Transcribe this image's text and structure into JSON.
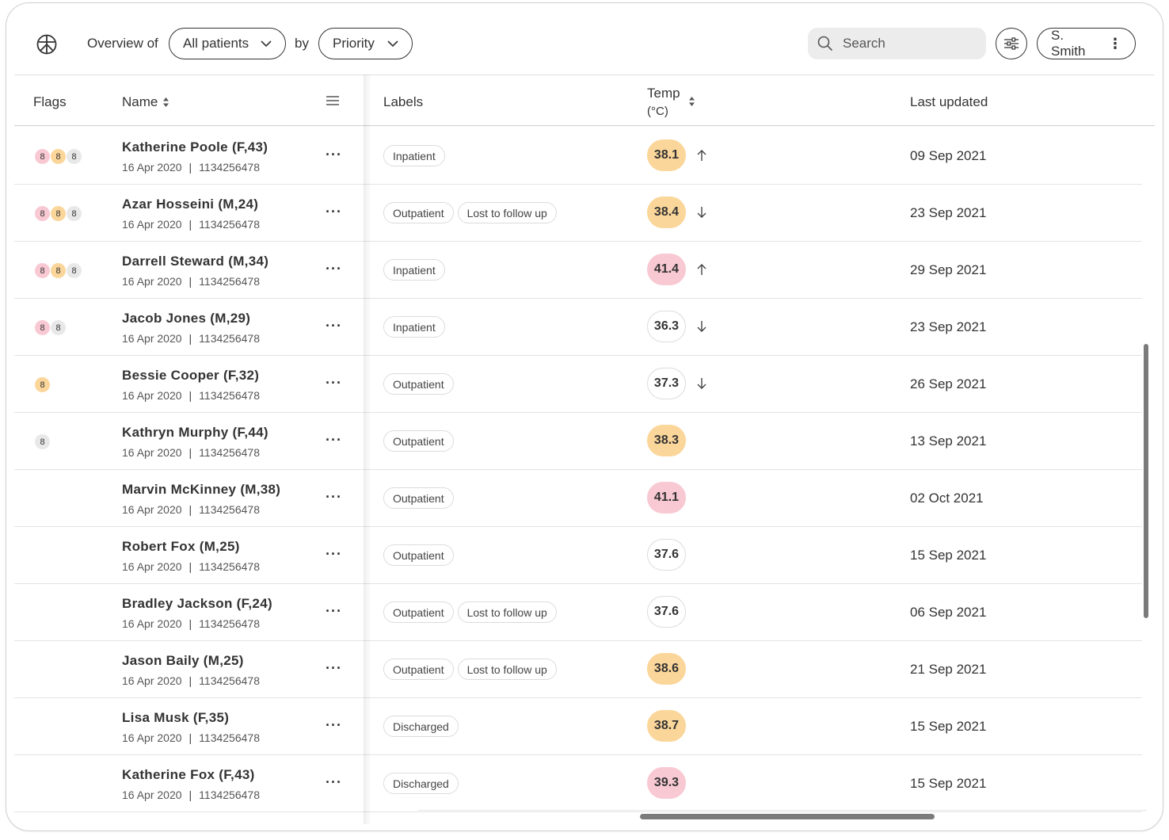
{
  "header": {
    "overview_label": "Overview of",
    "patients_filter": "All patients",
    "by_label": "by",
    "sort_filter": "Priority",
    "search_placeholder": "Search",
    "user_name": "S. Smith"
  },
  "columns": {
    "flags": "Flags",
    "name": "Name",
    "labels": "Labels",
    "temp_line1": "Temp",
    "temp_line2": "(°C)",
    "updated": "Last updated"
  },
  "colors": {
    "flag_red": "#f8c9d3",
    "flag_orange": "#fbd69a",
    "flag_grey": "#e8e8e8"
  },
  "patients": [
    {
      "name": "Katherine Poole (F,43)",
      "date": "16 Apr 2020",
      "id": "1134256478",
      "flags": [
        {
          "level": "red",
          "count": "8"
        },
        {
          "level": "orange",
          "count": "8"
        },
        {
          "level": "grey",
          "count": "8"
        }
      ],
      "labels": [
        "Inpatient"
      ],
      "temp": "38.1",
      "temp_level": "orange",
      "trend": "up",
      "updated": "09 Sep 2021"
    },
    {
      "name": "Azar Hosseini (M,24)",
      "date": "16 Apr 2020",
      "id": "1134256478",
      "flags": [
        {
          "level": "red",
          "count": "8"
        },
        {
          "level": "orange",
          "count": "8"
        },
        {
          "level": "grey",
          "count": "8"
        }
      ],
      "labels": [
        "Outpatient",
        "Lost to follow up"
      ],
      "temp": "38.4",
      "temp_level": "orange",
      "trend": "down",
      "updated": "23 Sep 2021"
    },
    {
      "name": "Darrell Steward (M,34)",
      "date": "16 Apr 2020",
      "id": "1134256478",
      "flags": [
        {
          "level": "red",
          "count": "8"
        },
        {
          "level": "orange",
          "count": "8"
        },
        {
          "level": "grey",
          "count": "8"
        }
      ],
      "labels": [
        "Inpatient"
      ],
      "temp": "41.4",
      "temp_level": "red",
      "trend": "up",
      "updated": "29 Sep 2021"
    },
    {
      "name": "Jacob Jones (M,29)",
      "date": "16 Apr 2020",
      "id": "1134256478",
      "flags": [
        {
          "level": "red",
          "count": "8"
        },
        {
          "level": "grey",
          "count": "8"
        }
      ],
      "labels": [
        "Inpatient"
      ],
      "temp": "36.3",
      "temp_level": "normal",
      "trend": "down",
      "updated": "23 Sep 2021"
    },
    {
      "name": "Bessie Cooper (F,32)",
      "date": "16 Apr 2020",
      "id": "1134256478",
      "flags": [
        {
          "level": "orange",
          "count": "8"
        }
      ],
      "labels": [
        "Outpatient"
      ],
      "temp": "37.3",
      "temp_level": "normal",
      "trend": "down",
      "updated": "26 Sep 2021"
    },
    {
      "name": "Kathryn Murphy (F,44)",
      "date": "16 Apr 2020",
      "id": "1134256478",
      "flags": [
        {
          "level": "grey",
          "count": "8"
        }
      ],
      "labels": [
        "Outpatient"
      ],
      "temp": "38.3",
      "temp_level": "orange",
      "trend": "",
      "updated": "13 Sep 2021"
    },
    {
      "name": "Marvin McKinney (M,38)",
      "date": "16 Apr 2020",
      "id": "1134256478",
      "flags": [],
      "labels": [
        "Outpatient"
      ],
      "temp": "41.1",
      "temp_level": "red",
      "trend": "",
      "updated": "02 Oct 2021"
    },
    {
      "name": "Robert Fox (M,25)",
      "date": "16 Apr 2020",
      "id": "1134256478",
      "flags": [],
      "labels": [
        "Outpatient"
      ],
      "temp": "37.6",
      "temp_level": "normal",
      "trend": "",
      "updated": "15 Sep 2021"
    },
    {
      "name": "Bradley Jackson (F,24)",
      "date": "16 Apr 2020",
      "id": "1134256478",
      "flags": [],
      "labels": [
        "Outpatient",
        "Lost to follow up"
      ],
      "temp": "37.6",
      "temp_level": "normal",
      "trend": "",
      "updated": "06 Sep 2021"
    },
    {
      "name": "Jason Baily (M,25)",
      "date": "16 Apr 2020",
      "id": "1134256478",
      "flags": [],
      "labels": [
        "Outpatient",
        "Lost to follow up"
      ],
      "temp": "38.6",
      "temp_level": "orange",
      "trend": "",
      "updated": "21 Sep 2021"
    },
    {
      "name": "Lisa Musk (F,35)",
      "date": "16 Apr 2020",
      "id": "1134256478",
      "flags": [],
      "labels": [
        "Discharged"
      ],
      "temp": "38.7",
      "temp_level": "orange",
      "trend": "",
      "updated": "15 Sep 2021"
    },
    {
      "name": "Katherine Fox (F,43)",
      "date": "16 Apr 2020",
      "id": "1134256478",
      "flags": [],
      "labels": [
        "Discharged"
      ],
      "temp": "39.3",
      "temp_level": "red",
      "trend": "",
      "updated": "15 Sep 2021"
    }
  ]
}
